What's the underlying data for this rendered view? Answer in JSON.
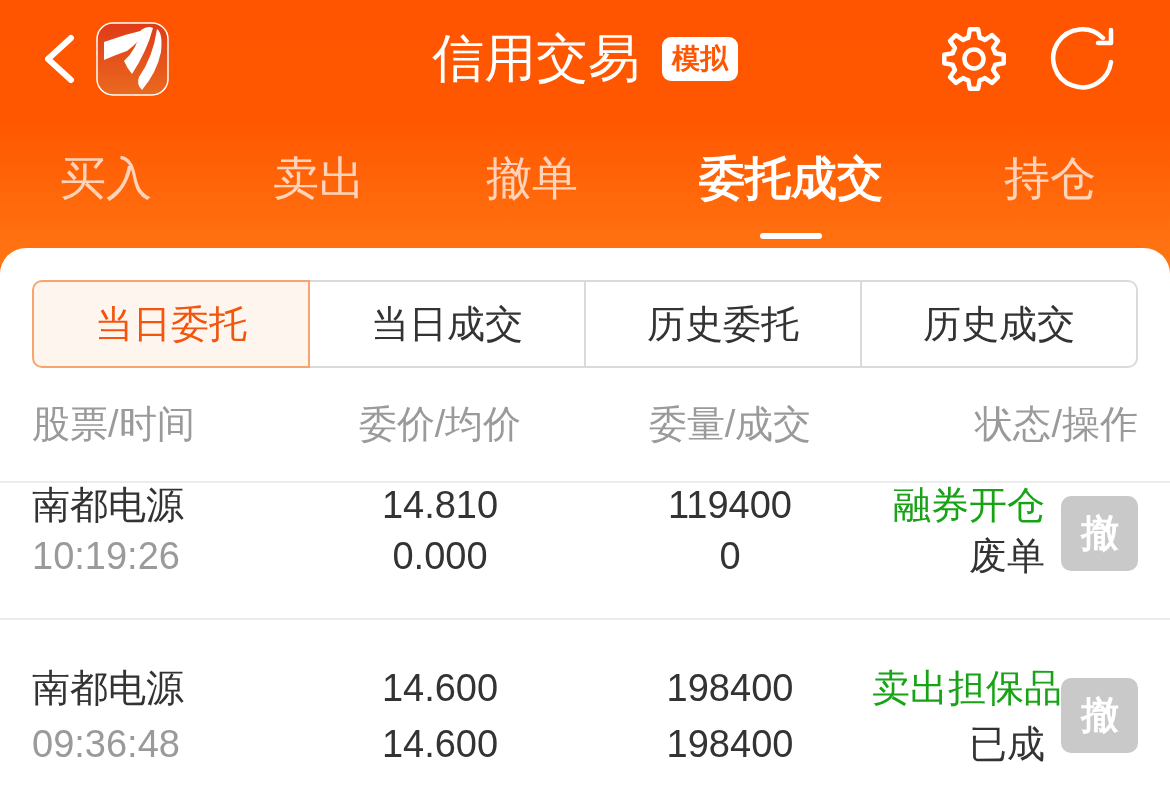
{
  "header": {
    "title": "信用交易",
    "badge": "模拟"
  },
  "tabs": [
    {
      "label": "买入",
      "selected": false
    },
    {
      "label": "卖出",
      "selected": false
    },
    {
      "label": "撤单",
      "selected": false
    },
    {
      "label": "委托成交",
      "selected": true
    },
    {
      "label": "持仓",
      "selected": false
    }
  ],
  "segments": [
    {
      "label": "当日委托",
      "selected": true
    },
    {
      "label": "当日成交",
      "selected": false
    },
    {
      "label": "历史委托",
      "selected": false
    },
    {
      "label": "历史成交",
      "selected": false
    }
  ],
  "columns": [
    "股票/时间",
    "委价/均价",
    "委量/成交",
    "状态/操作"
  ],
  "orders": [
    {
      "stock": "南都电源",
      "time": "10:19:26",
      "order_price": "14.810",
      "avg_price": "0.000",
      "order_qty": "119400",
      "filled_qty": "0",
      "type": "融券开仓",
      "status": "废单",
      "cancel": {
        "label": "撤",
        "disabled": true
      }
    },
    {
      "stock": "南都电源",
      "time": "09:36:48",
      "order_price": "14.600",
      "avg_price": "14.600",
      "order_qty": "198400",
      "filled_qty": "198400",
      "type": "卖出担保品",
      "status": "已成",
      "cancel": {
        "label": "撤",
        "disabled": true
      }
    }
  ]
}
